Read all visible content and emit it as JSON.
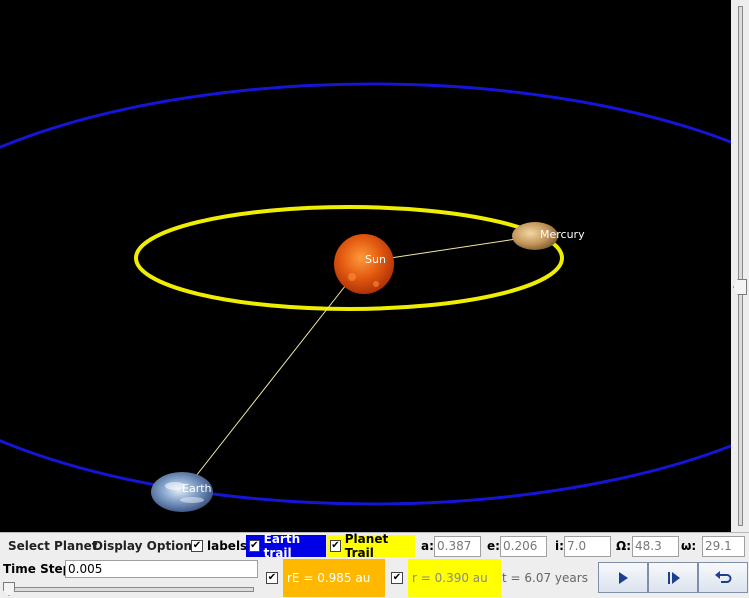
{
  "colors": {
    "background": "#000000",
    "earth_orbit": "#1515d6",
    "planet_orbit": "#f0ee00",
    "sun": "#e0520c",
    "connector_line": "#f3e9a0",
    "earth_trail_bg": "#0000e6",
    "planet_trail_bg": "#ffff00",
    "earth_distance_bg": "#ffb800",
    "planet_distance_bg": "#ffff00"
  },
  "scene": {
    "bodies": [
      {
        "name": "Sun",
        "label": "Sun"
      },
      {
        "name": "Mercury",
        "label": "Mercury"
      },
      {
        "name": "Earth",
        "label": "Earth"
      }
    ]
  },
  "toolbar": {
    "select_planet": "Select Planet",
    "display_options": "Display Options",
    "labels_checkbox": {
      "label": "labels",
      "checked": true
    },
    "earth_trail_checkbox": {
      "label": "Earth trail",
      "checked": true
    },
    "planet_trail_checkbox": {
      "label": "Planet Trail",
      "checked": true
    },
    "orbital_elements": [
      {
        "key": "a",
        "label": "a:",
        "value": "0.387"
      },
      {
        "key": "e",
        "label": "e:",
        "value": "0.206"
      },
      {
        "key": "i",
        "label": "i:",
        "value": "7.0"
      },
      {
        "key": "Omega",
        "label": "Ω:",
        "value": "48.3"
      },
      {
        "key": "omega",
        "label": "ω:",
        "value": "29.1"
      }
    ]
  },
  "bottom": {
    "time_step_label": "Time Step:",
    "time_step_value": "0.005",
    "time_step_slider": 0.0,
    "earth_distance": {
      "checked": true,
      "text": "rE = 0.985 au"
    },
    "planet_distance": {
      "checked": true,
      "text": "r = 0.390 au"
    },
    "time_readout": "t = 6.07 years",
    "buttons": [
      {
        "name": "play",
        "icon": "play-icon"
      },
      {
        "name": "step",
        "icon": "step-forward-icon"
      },
      {
        "name": "reset",
        "icon": "reset-icon"
      }
    ]
  },
  "view_slider": {
    "level": 0.54
  },
  "check_mark": "✔"
}
